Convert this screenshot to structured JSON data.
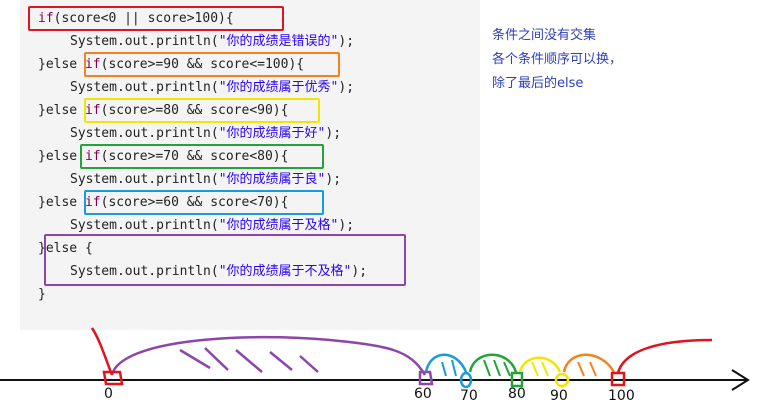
{
  "code": {
    "line1": {
      "kw": "if",
      "rest": "(score<0 || score>100){"
    },
    "line2": {
      "pre": "System.out.println(",
      "str": "\"你的成绩是错误的\"",
      "post": ");"
    },
    "line3": {
      "brace": "}else ",
      "kw": "if",
      "rest": "(score>=90 && score<=100){"
    },
    "line4": {
      "pre": "System.out.println(",
      "str": "\"你的成绩属于优秀\"",
      "post": ");"
    },
    "line5": {
      "brace": "}else ",
      "kw": "if",
      "rest": "(score>=80 && score<90){"
    },
    "line6": {
      "pre": "System.out.println(",
      "str": "\"你的成绩属于好\"",
      "post": ");"
    },
    "line7": {
      "brace": "}else ",
      "kw": "if",
      "rest": "(score>=70 && score<80){"
    },
    "line8": {
      "pre": "System.out.println(",
      "str": "\"你的成绩属于良\"",
      "post": ");"
    },
    "line9": {
      "brace": "}else ",
      "kw": "if",
      "rest": "(score>=60 && score<70){"
    },
    "line10": {
      "pre": "System.out.println(",
      "str": "\"你的成绩属于及格\"",
      "post": ");"
    },
    "line11": {
      "brace": "}else",
      "rest": " {"
    },
    "line12": {
      "pre": "System.out.println(",
      "str": "\"你的成绩属于不及格\"",
      "post": ");"
    },
    "line13": {
      "rest": "}"
    }
  },
  "notes": [
    "条件之间没有交集",
    "各个条件顺序可以换，",
    "除了最后的else"
  ],
  "number_line": {
    "ticks": [
      "0",
      "60",
      "70",
      "80",
      "90",
      "100"
    ]
  },
  "colors": {
    "red": "#e0141e",
    "orange": "#f58220",
    "yellow": "#f2e600",
    "green": "#23a33a",
    "blue": "#1a9bd7",
    "purple": "#8e44ad",
    "note_text": "#2e3fb8"
  }
}
